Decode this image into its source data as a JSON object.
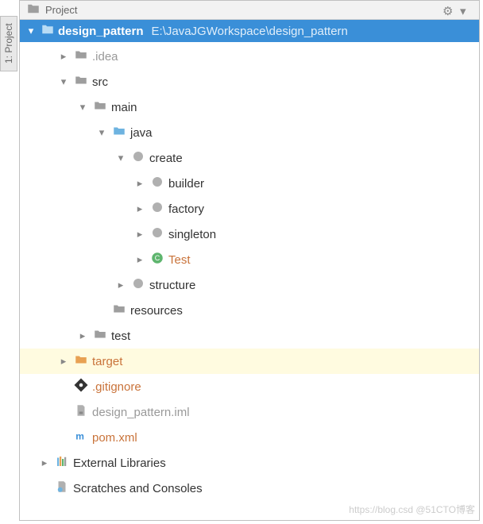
{
  "sidebar_tab": "1: Project",
  "toolbar": {
    "title": "Project"
  },
  "root": {
    "name": "design_pattern",
    "path": "E:\\JavaJGWorkspace\\design_pattern"
  },
  "tree": [
    {
      "depth": 1,
      "expand": "closed",
      "icon": "folder-gray",
      "label": ".idea",
      "style": "gray"
    },
    {
      "depth": 1,
      "expand": "open",
      "icon": "folder-gray",
      "label": "src"
    },
    {
      "depth": 2,
      "expand": "open",
      "icon": "folder-gray",
      "label": "main"
    },
    {
      "depth": 3,
      "expand": "open",
      "icon": "folder-blue",
      "label": "java"
    },
    {
      "depth": 4,
      "expand": "open",
      "icon": "package",
      "label": "create"
    },
    {
      "depth": 5,
      "expand": "closed",
      "icon": "package",
      "label": "builder"
    },
    {
      "depth": 5,
      "expand": "closed",
      "icon": "package",
      "label": "factory"
    },
    {
      "depth": 5,
      "expand": "closed",
      "icon": "package",
      "label": "singleton"
    },
    {
      "depth": 5,
      "expand": "closed",
      "icon": "class",
      "label": "Test",
      "style": "orange"
    },
    {
      "depth": 4,
      "expand": "closed",
      "icon": "package",
      "label": "structure"
    },
    {
      "depth": 3,
      "expand": "none",
      "icon": "folder-gray",
      "label": "resources"
    },
    {
      "depth": 2,
      "expand": "closed",
      "icon": "folder-gray",
      "label": "test"
    },
    {
      "depth": 1,
      "expand": "closed",
      "icon": "folder-orange",
      "label": "target",
      "style": "orange",
      "highlighted": true
    },
    {
      "depth": 1,
      "expand": "none",
      "icon": "gitignore",
      "label": ".gitignore",
      "style": "orange"
    },
    {
      "depth": 1,
      "expand": "none",
      "icon": "iml",
      "label": "design_pattern.iml",
      "style": "gray"
    },
    {
      "depth": 1,
      "expand": "none",
      "icon": "maven",
      "label": "pom.xml",
      "style": "orange"
    },
    {
      "depth": 0,
      "expand": "closed",
      "icon": "libraries",
      "label": "External Libraries"
    },
    {
      "depth": 0,
      "expand": "none",
      "icon": "scratches",
      "label": "Scratches and Consoles"
    }
  ],
  "watermark": "https://blog.csd @51CTO博客"
}
